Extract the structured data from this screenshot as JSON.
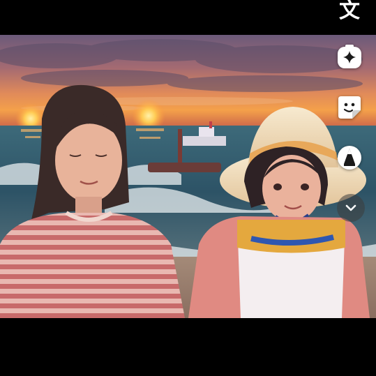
{
  "toolbar": {
    "translate_glyph": "文",
    "icons": [
      "translate-icon",
      "sparkle-icon",
      "sticker-icon",
      "pen-icon",
      "chevron-down-icon"
    ]
  },
  "colors": {
    "bar_background": "#000000",
    "icon_color": "#ffffff",
    "expand_button_bg": "rgba(60,60,60,0.55)"
  }
}
